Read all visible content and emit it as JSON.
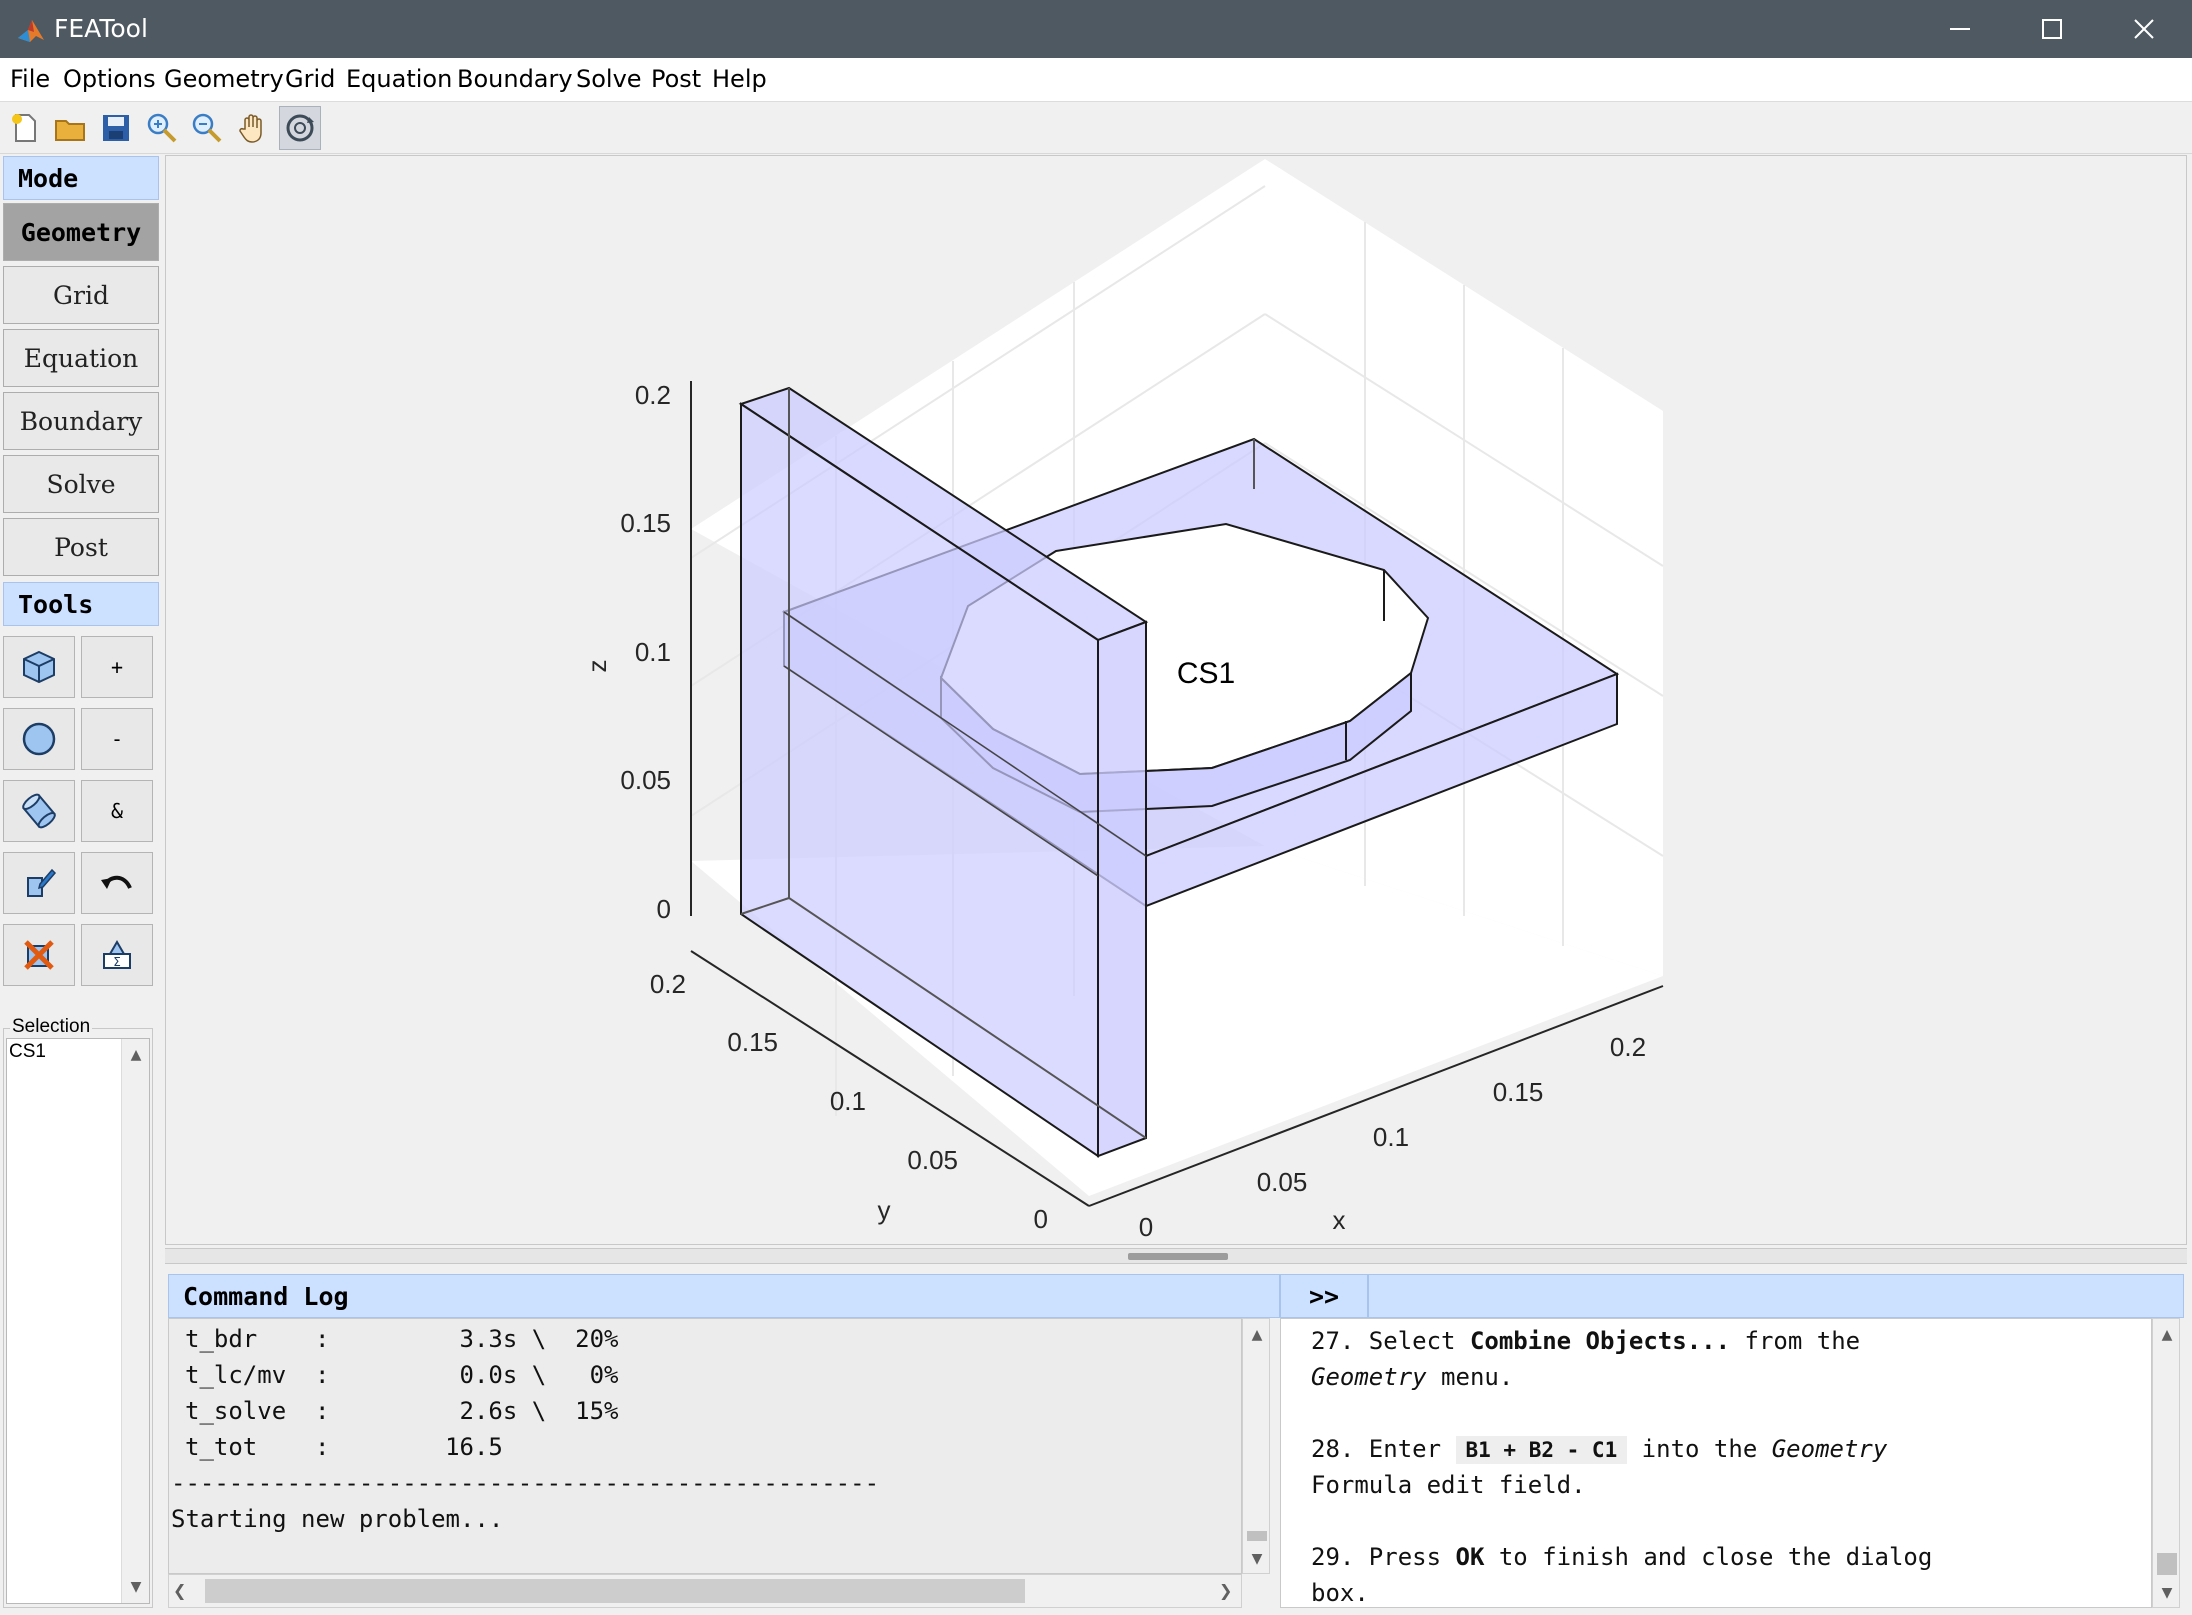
{
  "window": {
    "title": "FEATool",
    "minimize_icon": "minimize-icon",
    "maximize_icon": "maximize-icon",
    "close_icon": "close-icon"
  },
  "menu": [
    "File",
    "Options",
    "Geometry",
    "Grid",
    "Equation",
    "Boundary",
    "Solve",
    "Post",
    "Help"
  ],
  "toolbar": [
    "new-file-icon",
    "open-folder-icon",
    "save-icon",
    "zoom-in-icon",
    "zoom-out-icon",
    "pan-hand-icon",
    "rotate-3d-icon"
  ],
  "sidebar": {
    "mode_label": "Mode",
    "modes": [
      "Geometry",
      "Grid",
      "Equation",
      "Boundary",
      "Solve",
      "Post"
    ],
    "active_mode": "Geometry",
    "tools_label": "Tools",
    "tools": [
      {
        "icon": "cube-icon",
        "label": ""
      },
      {
        "icon": "",
        "label": "+"
      },
      {
        "icon": "circle-icon",
        "label": ""
      },
      {
        "icon": "",
        "label": "-"
      },
      {
        "icon": "cylinder-icon",
        "label": ""
      },
      {
        "icon": "",
        "label": "&"
      },
      {
        "icon": "edit-object-icon",
        "label": ""
      },
      {
        "icon": "undo-icon",
        "label": ""
      },
      {
        "icon": "delete-object-icon",
        "label": ""
      },
      {
        "icon": "geometry-tools-icon",
        "label": ""
      }
    ],
    "selection_label": "Selection",
    "selection_items": [
      "CS1"
    ]
  },
  "plot": {
    "object_label": "CS1",
    "z_axis": {
      "label": "z",
      "ticks": [
        "0",
        "0.05",
        "0.1",
        "0.15",
        "0.2"
      ]
    },
    "y_axis": {
      "label": "y",
      "ticks": [
        "0",
        "0.05",
        "0.1",
        "0.15",
        "0.2"
      ]
    },
    "x_axis": {
      "label": "x",
      "ticks": [
        "0",
        "0.05",
        "0.1",
        "0.15",
        "0.2"
      ]
    },
    "face_color": "#ccccff"
  },
  "command_log": {
    "title": "Command Log",
    "lines": [
      "t_bdr    :         3.3s \\  20%",
      "t_lc/mv  :         0.0s \\   0%",
      "t_solve  :         2.6s \\  15%",
      "t_tot    :        16.5",
      "-------------------------------------------------",
      "Starting new problem..."
    ]
  },
  "help_panel": {
    "toggle_label": ">>",
    "step27": {
      "prefix": "27. Select ",
      "bold": "Combine Objects...",
      "suffix": " from the",
      "line2_italic": "Geometry",
      "line2_rest": " menu."
    },
    "step28": {
      "prefix": "28. Enter ",
      "code": "B1 + B2 - C1",
      "mid": " into the ",
      "italic": "Geometry",
      "line2": "Formula edit field."
    },
    "step29": {
      "prefix": "29. Press ",
      "bold": "OK",
      "suffix": " to finish and close the dialog",
      "line2": "box."
    }
  }
}
